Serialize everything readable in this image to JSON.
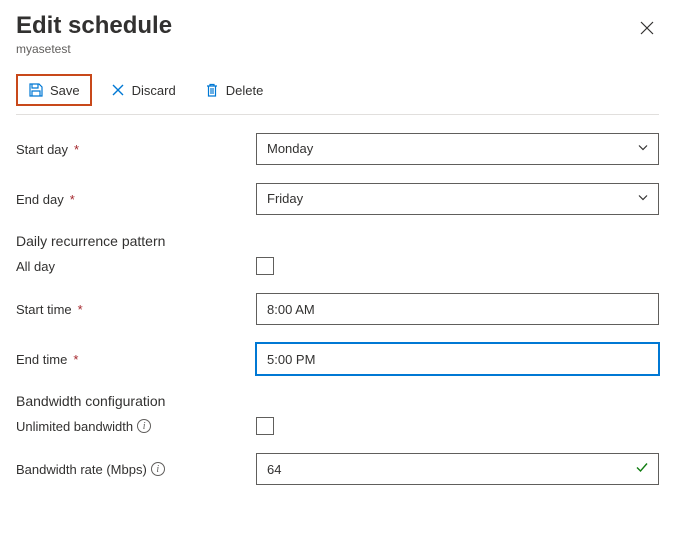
{
  "header": {
    "title": "Edit schedule",
    "subtitle": "myasetest"
  },
  "toolbar": {
    "save_label": "Save",
    "discard_label": "Discard",
    "delete_label": "Delete"
  },
  "form": {
    "start_day": {
      "label": "Start day",
      "value": "Monday"
    },
    "end_day": {
      "label": "End day",
      "value": "Friday"
    },
    "recurrence_heading": "Daily recurrence pattern",
    "all_day": {
      "label": "All day"
    },
    "start_time": {
      "label": "Start time",
      "value": "8:00 AM"
    },
    "end_time": {
      "label": "End time",
      "value": "5:00 PM"
    },
    "bandwidth_heading": "Bandwidth configuration",
    "unlimited": {
      "label": "Unlimited bandwidth"
    },
    "rate": {
      "label": "Bandwidth rate (Mbps)",
      "value": "64"
    }
  }
}
